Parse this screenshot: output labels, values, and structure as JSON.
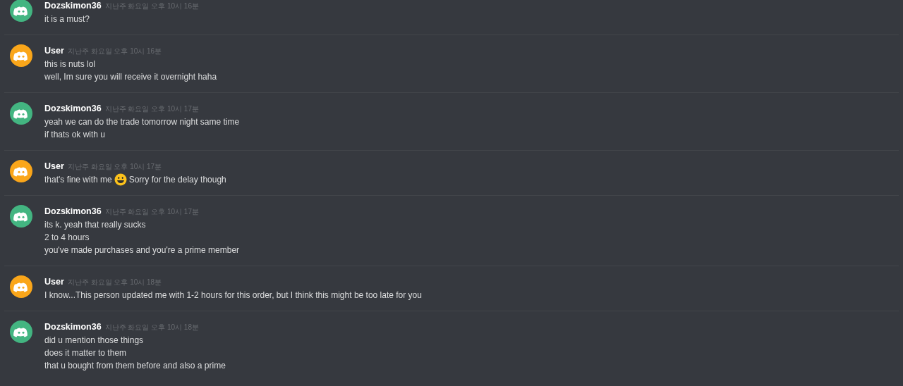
{
  "messages": [
    {
      "author": "Dozskimon36",
      "color": "#43b581",
      "time": "지난주 화요일 오후 10시 16분",
      "lines": [
        {
          "kind": "text",
          "text": "it is a must?"
        }
      ]
    },
    {
      "author": "User",
      "color": "#faa61a",
      "time": "지난주 화요일 오후 10시 16분",
      "lines": [
        {
          "kind": "text",
          "text": "this is nuts lol"
        },
        {
          "kind": "text",
          "text": "well, Im sure you will receive it overnight haha"
        }
      ]
    },
    {
      "author": "Dozskimon36",
      "color": "#43b581",
      "time": "지난주 화요일 오후 10시 17분",
      "lines": [
        {
          "kind": "text",
          "text": "yeah we can do the trade tomorrow night same time"
        },
        {
          "kind": "text",
          "text": "if thats ok with u"
        }
      ]
    },
    {
      "author": "User",
      "color": "#faa61a",
      "time": "지난주 화요일 오후 10시 17분",
      "lines": [
        {
          "kind": "emoji",
          "before": "that's fine with me",
          "after": "Sorry for the delay though"
        }
      ]
    },
    {
      "author": "Dozskimon36",
      "color": "#43b581",
      "time": "지난주 화요일 오후 10시 17분",
      "lines": [
        {
          "kind": "text",
          "text": "its k. yeah that really sucks"
        },
        {
          "kind": "text",
          "text": "2 to 4 hours"
        },
        {
          "kind": "text",
          "text": "you've made purchases and you're a prime member"
        }
      ]
    },
    {
      "author": "User",
      "color": "#faa61a",
      "time": "지난주 화요일 오후 10시 18분",
      "lines": [
        {
          "kind": "text",
          "text": "I know...This person updated me with 1-2 hours for this order, but I think this might be too late for you"
        }
      ]
    },
    {
      "author": "Dozskimon36",
      "color": "#43b581",
      "time": "지난주 화요일 오후 10시 18분",
      "lines": [
        {
          "kind": "text",
          "text": "did u mention those things"
        },
        {
          "kind": "text",
          "text": "does it matter to them"
        },
        {
          "kind": "text",
          "text": "that u bought from them before and also a prime"
        }
      ]
    }
  ]
}
